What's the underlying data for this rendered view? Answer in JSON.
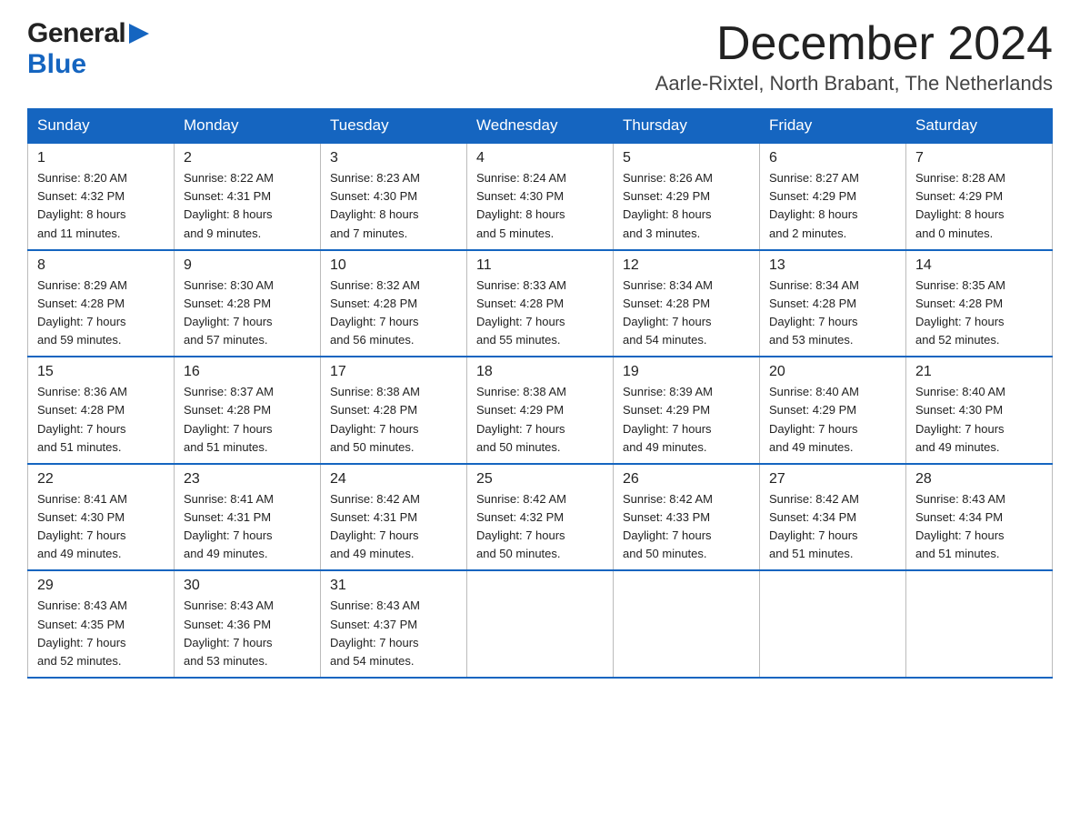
{
  "header": {
    "logo_general": "General",
    "logo_blue": "Blue",
    "month_title": "December 2024",
    "location": "Aarle-Rixtel, North Brabant, The Netherlands"
  },
  "days_of_week": [
    "Sunday",
    "Monday",
    "Tuesday",
    "Wednesday",
    "Thursday",
    "Friday",
    "Saturday"
  ],
  "weeks": [
    [
      {
        "day": "1",
        "sunrise": "Sunrise: 8:20 AM",
        "sunset": "Sunset: 4:32 PM",
        "daylight": "Daylight: 8 hours",
        "daylight2": "and 11 minutes."
      },
      {
        "day": "2",
        "sunrise": "Sunrise: 8:22 AM",
        "sunset": "Sunset: 4:31 PM",
        "daylight": "Daylight: 8 hours",
        "daylight2": "and 9 minutes."
      },
      {
        "day": "3",
        "sunrise": "Sunrise: 8:23 AM",
        "sunset": "Sunset: 4:30 PM",
        "daylight": "Daylight: 8 hours",
        "daylight2": "and 7 minutes."
      },
      {
        "day": "4",
        "sunrise": "Sunrise: 8:24 AM",
        "sunset": "Sunset: 4:30 PM",
        "daylight": "Daylight: 8 hours",
        "daylight2": "and 5 minutes."
      },
      {
        "day": "5",
        "sunrise": "Sunrise: 8:26 AM",
        "sunset": "Sunset: 4:29 PM",
        "daylight": "Daylight: 8 hours",
        "daylight2": "and 3 minutes."
      },
      {
        "day": "6",
        "sunrise": "Sunrise: 8:27 AM",
        "sunset": "Sunset: 4:29 PM",
        "daylight": "Daylight: 8 hours",
        "daylight2": "and 2 minutes."
      },
      {
        "day": "7",
        "sunrise": "Sunrise: 8:28 AM",
        "sunset": "Sunset: 4:29 PM",
        "daylight": "Daylight: 8 hours",
        "daylight2": "and 0 minutes."
      }
    ],
    [
      {
        "day": "8",
        "sunrise": "Sunrise: 8:29 AM",
        "sunset": "Sunset: 4:28 PM",
        "daylight": "Daylight: 7 hours",
        "daylight2": "and 59 minutes."
      },
      {
        "day": "9",
        "sunrise": "Sunrise: 8:30 AM",
        "sunset": "Sunset: 4:28 PM",
        "daylight": "Daylight: 7 hours",
        "daylight2": "and 57 minutes."
      },
      {
        "day": "10",
        "sunrise": "Sunrise: 8:32 AM",
        "sunset": "Sunset: 4:28 PM",
        "daylight": "Daylight: 7 hours",
        "daylight2": "and 56 minutes."
      },
      {
        "day": "11",
        "sunrise": "Sunrise: 8:33 AM",
        "sunset": "Sunset: 4:28 PM",
        "daylight": "Daylight: 7 hours",
        "daylight2": "and 55 minutes."
      },
      {
        "day": "12",
        "sunrise": "Sunrise: 8:34 AM",
        "sunset": "Sunset: 4:28 PM",
        "daylight": "Daylight: 7 hours",
        "daylight2": "and 54 minutes."
      },
      {
        "day": "13",
        "sunrise": "Sunrise: 8:34 AM",
        "sunset": "Sunset: 4:28 PM",
        "daylight": "Daylight: 7 hours",
        "daylight2": "and 53 minutes."
      },
      {
        "day": "14",
        "sunrise": "Sunrise: 8:35 AM",
        "sunset": "Sunset: 4:28 PM",
        "daylight": "Daylight: 7 hours",
        "daylight2": "and 52 minutes."
      }
    ],
    [
      {
        "day": "15",
        "sunrise": "Sunrise: 8:36 AM",
        "sunset": "Sunset: 4:28 PM",
        "daylight": "Daylight: 7 hours",
        "daylight2": "and 51 minutes."
      },
      {
        "day": "16",
        "sunrise": "Sunrise: 8:37 AM",
        "sunset": "Sunset: 4:28 PM",
        "daylight": "Daylight: 7 hours",
        "daylight2": "and 51 minutes."
      },
      {
        "day": "17",
        "sunrise": "Sunrise: 8:38 AM",
        "sunset": "Sunset: 4:28 PM",
        "daylight": "Daylight: 7 hours",
        "daylight2": "and 50 minutes."
      },
      {
        "day": "18",
        "sunrise": "Sunrise: 8:38 AM",
        "sunset": "Sunset: 4:29 PM",
        "daylight": "Daylight: 7 hours",
        "daylight2": "and 50 minutes."
      },
      {
        "day": "19",
        "sunrise": "Sunrise: 8:39 AM",
        "sunset": "Sunset: 4:29 PM",
        "daylight": "Daylight: 7 hours",
        "daylight2": "and 49 minutes."
      },
      {
        "day": "20",
        "sunrise": "Sunrise: 8:40 AM",
        "sunset": "Sunset: 4:29 PM",
        "daylight": "Daylight: 7 hours",
        "daylight2": "and 49 minutes."
      },
      {
        "day": "21",
        "sunrise": "Sunrise: 8:40 AM",
        "sunset": "Sunset: 4:30 PM",
        "daylight": "Daylight: 7 hours",
        "daylight2": "and 49 minutes."
      }
    ],
    [
      {
        "day": "22",
        "sunrise": "Sunrise: 8:41 AM",
        "sunset": "Sunset: 4:30 PM",
        "daylight": "Daylight: 7 hours",
        "daylight2": "and 49 minutes."
      },
      {
        "day": "23",
        "sunrise": "Sunrise: 8:41 AM",
        "sunset": "Sunset: 4:31 PM",
        "daylight": "Daylight: 7 hours",
        "daylight2": "and 49 minutes."
      },
      {
        "day": "24",
        "sunrise": "Sunrise: 8:42 AM",
        "sunset": "Sunset: 4:31 PM",
        "daylight": "Daylight: 7 hours",
        "daylight2": "and 49 minutes."
      },
      {
        "day": "25",
        "sunrise": "Sunrise: 8:42 AM",
        "sunset": "Sunset: 4:32 PM",
        "daylight": "Daylight: 7 hours",
        "daylight2": "and 50 minutes."
      },
      {
        "day": "26",
        "sunrise": "Sunrise: 8:42 AM",
        "sunset": "Sunset: 4:33 PM",
        "daylight": "Daylight: 7 hours",
        "daylight2": "and 50 minutes."
      },
      {
        "day": "27",
        "sunrise": "Sunrise: 8:42 AM",
        "sunset": "Sunset: 4:34 PM",
        "daylight": "Daylight: 7 hours",
        "daylight2": "and 51 minutes."
      },
      {
        "day": "28",
        "sunrise": "Sunrise: 8:43 AM",
        "sunset": "Sunset: 4:34 PM",
        "daylight": "Daylight: 7 hours",
        "daylight2": "and 51 minutes."
      }
    ],
    [
      {
        "day": "29",
        "sunrise": "Sunrise: 8:43 AM",
        "sunset": "Sunset: 4:35 PM",
        "daylight": "Daylight: 7 hours",
        "daylight2": "and 52 minutes."
      },
      {
        "day": "30",
        "sunrise": "Sunrise: 8:43 AM",
        "sunset": "Sunset: 4:36 PM",
        "daylight": "Daylight: 7 hours",
        "daylight2": "and 53 minutes."
      },
      {
        "day": "31",
        "sunrise": "Sunrise: 8:43 AM",
        "sunset": "Sunset: 4:37 PM",
        "daylight": "Daylight: 7 hours",
        "daylight2": "and 54 minutes."
      },
      null,
      null,
      null,
      null
    ]
  ]
}
